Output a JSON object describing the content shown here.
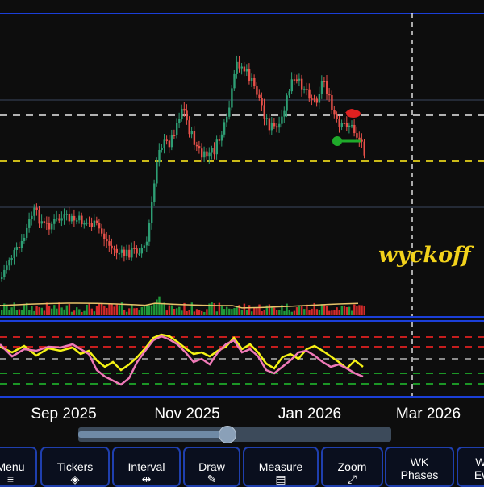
{
  "chart_data": {
    "type": "candlestick",
    "watermark": "wyckoff",
    "x_ticks": [
      "Sep 2025",
      "Nov 2025",
      "Jan 2026",
      "Mar 2026"
    ],
    "colors": {
      "up": "#2e9e74",
      "down": "#e8514a",
      "volume_ma": "#e8c46a",
      "osc_yellow": "#f4f214",
      "osc_pink": "#f07ab8",
      "level_white": "#e9e9e9",
      "level_yellow": "#e6d21a",
      "level_red": "#e02020",
      "level_green": "#1faa2a",
      "frame_blue": "#1b3fd8"
    },
    "markers": [
      {
        "type": "sell-signal",
        "color": "#e02020"
      },
      {
        "type": "buy-signal",
        "color": "#1faa2a"
      }
    ]
  },
  "toolbar": {
    "menu": "Menu",
    "tickers": "Tickers",
    "interval": "Interval",
    "draw": "Draw",
    "measure": "Measure",
    "zoom": "Zoom",
    "wk_line1": "WK",
    "wk_line2": "Phases",
    "wk_extra1": "W",
    "wk_extra2": "Ev"
  },
  "icons": {
    "tickers": "layers-icon",
    "interval": "interval-icon",
    "draw": "pencil-icon",
    "measure": "ruler-icon",
    "zoom": "expand-icon",
    "menu": "menu-icon"
  }
}
